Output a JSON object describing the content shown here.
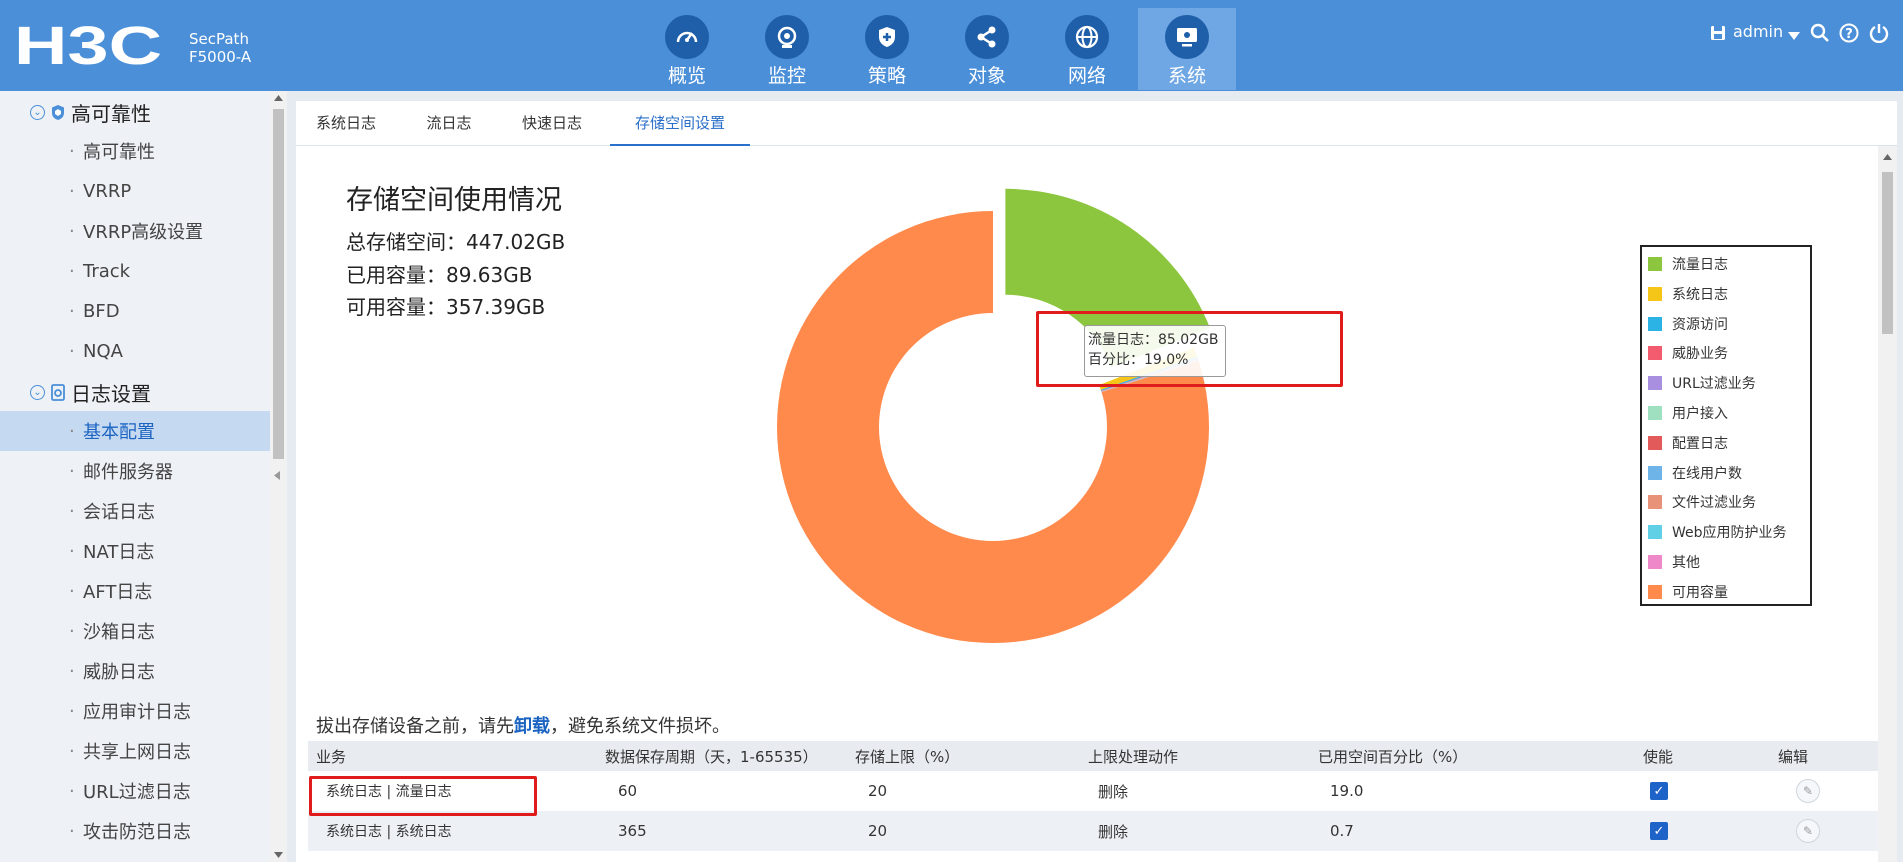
{
  "header": {
    "brand": "H3C",
    "model_line1": "SecPath",
    "model_line2": "F5000-A",
    "nav": [
      {
        "label": "概览",
        "icon": "gauge-icon"
      },
      {
        "label": "监控",
        "icon": "monitor-eye-icon"
      },
      {
        "label": "策略",
        "icon": "shield-plus-icon"
      },
      {
        "label": "对象",
        "icon": "share-nodes-icon"
      },
      {
        "label": "网络",
        "icon": "globe-icon"
      },
      {
        "label": "系统",
        "icon": "computer-screen-icon"
      }
    ],
    "active_nav": "系统",
    "user": "admin"
  },
  "sidebar": {
    "groups": [
      {
        "label": "高可靠性",
        "items": [
          "高可靠性",
          "VRRP",
          "VRRP高级设置",
          "Track",
          "BFD",
          "NQA"
        ]
      },
      {
        "label": "日志设置",
        "items": [
          "基本配置",
          "邮件服务器",
          "会话日志",
          "NAT日志",
          "AFT日志",
          "沙箱日志",
          "威胁日志",
          "应用审计日志",
          "共享上网日志",
          "URL过滤日志",
          "攻击防范日志"
        ]
      }
    ],
    "active_item": "基本配置"
  },
  "tabs": [
    "系统日志",
    "流日志",
    "快速日志",
    "存储空间设置"
  ],
  "active_tab": "存储空间设置",
  "storage": {
    "title": "存储空间使用情况",
    "total": "总存储空间：447.02GB",
    "used": "已用容量：89.63GB",
    "free": "可用容量：357.39GB"
  },
  "chart_data": {
    "type": "pie",
    "variant": "donut",
    "title": "",
    "legend_position": "right",
    "series": [
      {
        "name": "流量日志",
        "value": 85.02,
        "color": "#8cc63f"
      },
      {
        "name": "系统日志",
        "value": 3.13,
        "color": "#f5c518"
      },
      {
        "name": "资源访问",
        "value": 0.6,
        "color": "#2bb3e6"
      },
      {
        "name": "威胁业务",
        "value": 0.2,
        "color": "#f25c6e"
      },
      {
        "name": "URL过滤业务",
        "value": 0.2,
        "color": "#a98fe0"
      },
      {
        "name": "用户接入",
        "value": 0.1,
        "color": "#9ee0c0"
      },
      {
        "name": "配置日志",
        "value": 0.1,
        "color": "#e25a5a"
      },
      {
        "name": "在线用户数",
        "value": 0.1,
        "color": "#6fb4e8"
      },
      {
        "name": "文件过滤业务",
        "value": 0.06,
        "color": "#e8927a"
      },
      {
        "name": "Web应用防护业务",
        "value": 0.06,
        "color": "#5fd0e6"
      },
      {
        "name": "其他",
        "value": 0.06,
        "color": "#ee88c8"
      },
      {
        "name": "可用容量",
        "value": 357.39,
        "color": "#ff8a4c"
      }
    ],
    "highlighted": "流量日志"
  },
  "tooltip": {
    "line1": "流量日志：85.02GB",
    "line2": "百分比：19.0%"
  },
  "warning": {
    "before": "拔出存储设备之前，请先",
    "link": "卸载",
    "after": "，避免系统文件损坏。"
  },
  "table": {
    "headers": [
      "业务",
      "数据保存周期（天，1-65535）",
      "存储上限（%）",
      "上限处理动作",
      "已用空间百分比（%）",
      "使能",
      "编辑"
    ],
    "rows": [
      {
        "service": "系统日志 | 流量日志",
        "period": "60",
        "limit": "20",
        "action": "删除",
        "used_pct": "19.0",
        "enabled": true
      },
      {
        "service": "系统日志 | 系统日志",
        "period": "365",
        "limit": "20",
        "action": "删除",
        "used_pct": "0.7",
        "enabled": true
      }
    ]
  }
}
